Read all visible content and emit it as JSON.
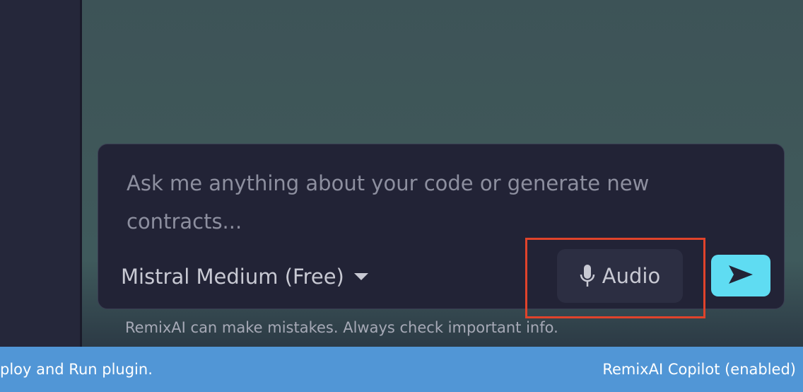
{
  "composer": {
    "placeholder": "Ask me anything about your code or generate new contracts...",
    "model_label": "Mistral Medium (Free)",
    "audio_label": "Audio",
    "disclaimer": "RemixAI can make mistakes. Always check important info."
  },
  "status_bar": {
    "left_text": "ploy and Run plugin.",
    "right_text": "RemixAI Copilot (enabled)"
  },
  "icons": {
    "model_caret": "caret-down-icon",
    "audio": "microphone-icon",
    "send": "paper-plane-send-icon"
  },
  "colors": {
    "accent_send": "#5fdcf2",
    "status_bar": "#5196d6",
    "highlight": "#e0432b",
    "composer_bg": "#222336"
  }
}
